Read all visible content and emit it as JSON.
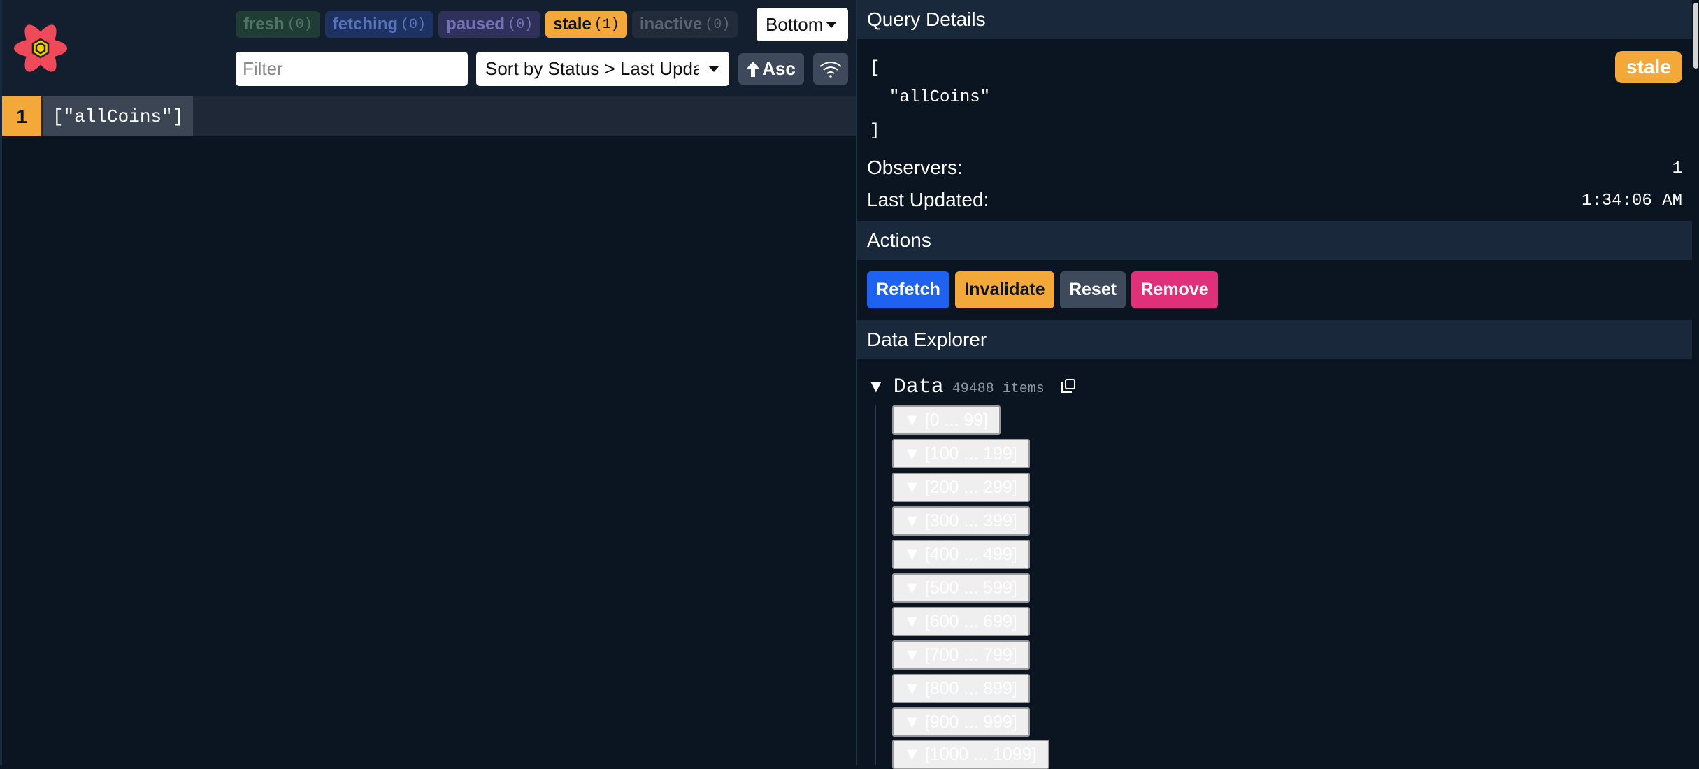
{
  "toolbar": {
    "badges": [
      {
        "label": "fresh",
        "count": "(0)"
      },
      {
        "label": "fetching",
        "count": "(0)"
      },
      {
        "label": "paused",
        "count": "(0)"
      },
      {
        "label": "stale",
        "count": "(1)"
      },
      {
        "label": "inactive",
        "count": "(0)"
      }
    ],
    "position_select": "Bottom",
    "filter_placeholder": "Filter",
    "sort_select": "Sort by Status > Last Updated",
    "sort_direction": "Asc"
  },
  "query_list": [
    {
      "observers": "1",
      "key": "[\"allCoins\"]",
      "status_color": "#f3a93a"
    }
  ],
  "details": {
    "section_title": "Query Details",
    "json_lines": [
      "[",
      "\"allCoins\"",
      "]"
    ],
    "status_badge": "stale",
    "observers_label": "Observers:",
    "observers_value": "1",
    "last_updated_label": "Last Updated:",
    "last_updated_value": "1:34:06 AM"
  },
  "actions": {
    "section_title": "Actions",
    "refetch": "Refetch",
    "invalidate": "Invalidate",
    "reset": "Reset",
    "remove": "Remove"
  },
  "explorer": {
    "section_title": "Data Explorer",
    "root_label": "Data",
    "root_count": "49488 items",
    "ranges": [
      "[0 ... 99]",
      "[100 ... 199]",
      "[200 ... 299]",
      "[300 ... 399]",
      "[400 ... 499]",
      "[500 ... 599]",
      "[600 ... 699]",
      "[700 ... 799]",
      "[800 ... 899]",
      "[900 ... 999]",
      "[1000 ... 1099]"
    ]
  },
  "colors": {
    "background": "#0b1521",
    "stale": "#f3a93a",
    "refetch": "#1f62f0",
    "remove": "#e0307a"
  },
  "icons": [
    "react-query-logo",
    "caret-down-icon",
    "arrow-up-icon",
    "wifi-icon",
    "copy-icon",
    "expand-triangle-icon"
  ]
}
